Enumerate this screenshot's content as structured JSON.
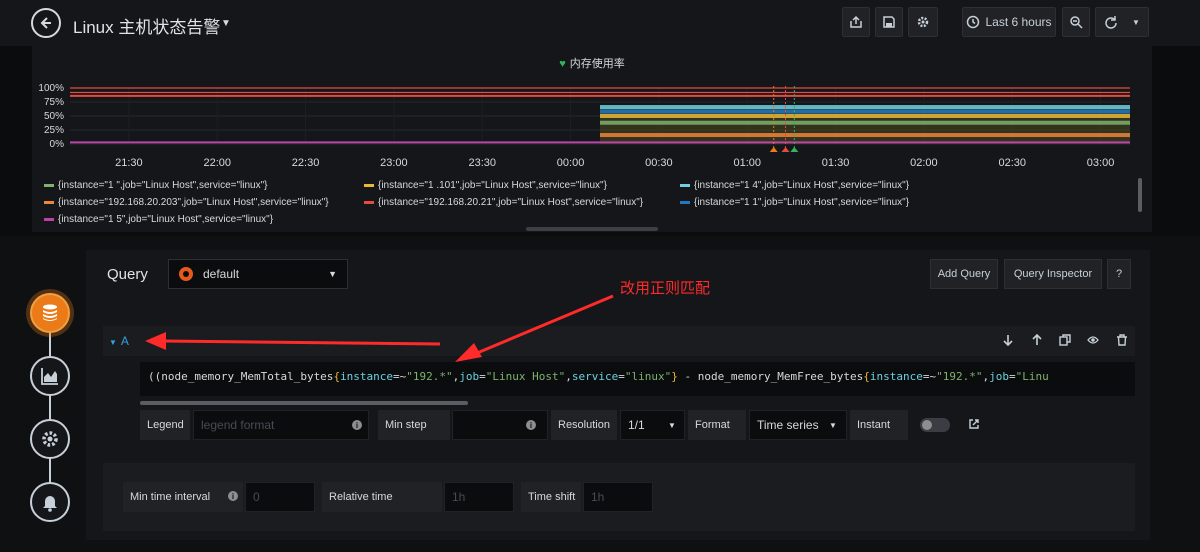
{
  "topbar": {
    "title": "Linux 主机状态告警",
    "time_range": "Last 6 hours"
  },
  "panel": {
    "title": "内存使用率",
    "chart_data": {
      "type": "line",
      "y_ticks": [
        "100%",
        "75%",
        "50%",
        "25%",
        "0%"
      ],
      "x_ticks": [
        "21:30",
        "22:00",
        "22:30",
        "23:00",
        "23:30",
        "00:00",
        "00:30",
        "01:00",
        "01:30",
        "02:00",
        "02:30",
        "03:00"
      ],
      "ylim": [
        0,
        100
      ],
      "series": [
        {
          "color": "#7eb26d",
          "start": "00:10",
          "value": 38
        },
        {
          "color": "#eab839",
          "start": "00:10",
          "value": 50
        },
        {
          "color": "#6ed0e0",
          "start": "00:10",
          "value": 66
        },
        {
          "color": "#ef843c",
          "start": "00:10",
          "value": 16
        },
        {
          "color": "#e24d42",
          "start": "21:10",
          "value": 86
        },
        {
          "color": "#1f78c1",
          "start": "00:10",
          "value": 58
        },
        {
          "color": "#ba43a9",
          "start": "21:10",
          "value": 3
        }
      ],
      "thresholds": [
        {
          "color": "#e24d42",
          "value": 100
        },
        {
          "color": "#e24d42",
          "value": 92
        }
      ],
      "annotations": [
        {
          "color": "#eb7b18",
          "time": "01:09"
        },
        {
          "color": "#e24d42",
          "time": "01:13"
        },
        {
          "color": "#33b35d",
          "time": "01:16"
        }
      ],
      "grid": true
    },
    "legend": [
      {
        "color": "#7eb26d",
        "text": "{instance=\"1          \",job=\"Linux Host\",service=\"linux\"}"
      },
      {
        "color": "#eab839",
        "text": "{instance=\"1         .101\",job=\"Linux Host\",service=\"linux\"}"
      },
      {
        "color": "#6ed0e0",
        "text": "{instance=\"1          4\",job=\"Linux Host\",service=\"linux\"}"
      },
      {
        "color": "#ef843c",
        "text": "{instance=\"192.168.20.203\",job=\"Linux Host\",service=\"linux\"}"
      },
      {
        "color": "#e24d42",
        "text": "{instance=\"192.168.20.21\",job=\"Linux Host\",service=\"linux\"}"
      },
      {
        "color": "#1f78c1",
        "text": "{instance=\"1          1\",job=\"Linux Host\",service=\"linux\"}"
      },
      {
        "color": "#ba43a9",
        "text": "{instance=\"1          5\",job=\"Linux Host\",service=\"linux\"}"
      }
    ]
  },
  "query": {
    "label": "Query",
    "datasource": "default",
    "add_query": "Add Query",
    "query_inspector": "Query Inspector",
    "help": "?",
    "row_letter": "A",
    "annotation": "改用正则匹配",
    "expr_parts": [
      {
        "t": "((node_memory_MemTotal_bytes",
        "c": "#d8d9da"
      },
      {
        "t": "{",
        "c": "#eab839"
      },
      {
        "t": "instance",
        "c": "#6ed0e0"
      },
      {
        "t": "=~",
        "c": "#d8d9da"
      },
      {
        "t": "\"192.*\"",
        "c": "#7eb26d"
      },
      {
        "t": ",",
        "c": "#d8d9da"
      },
      {
        "t": "job",
        "c": "#6ed0e0"
      },
      {
        "t": "=",
        "c": "#d8d9da"
      },
      {
        "t": "\"Linux Host\"",
        "c": "#7eb26d"
      },
      {
        "t": ",",
        "c": "#d8d9da"
      },
      {
        "t": "service",
        "c": "#6ed0e0"
      },
      {
        "t": "=",
        "c": "#d8d9da"
      },
      {
        "t": "\"linux\"",
        "c": "#7eb26d"
      },
      {
        "t": "}",
        "c": "#eab839"
      },
      {
        "t": " - node_memory_MemFree_bytes",
        "c": "#d8d9da"
      },
      {
        "t": "{",
        "c": "#eab839"
      },
      {
        "t": "instance",
        "c": "#6ed0e0"
      },
      {
        "t": "=~",
        "c": "#d8d9da"
      },
      {
        "t": "\"192.*\"",
        "c": "#7eb26d"
      },
      {
        "t": ",",
        "c": "#d8d9da"
      },
      {
        "t": "job",
        "c": "#6ed0e0"
      },
      {
        "t": "=",
        "c": "#d8d9da"
      },
      {
        "t": "\"Linu",
        "c": "#7eb26d"
      }
    ],
    "options": {
      "legend_label": "Legend",
      "legend_placeholder": "legend format",
      "min_step_label": "Min step",
      "resolution_label": "Resolution",
      "resolution_value": "1/1",
      "format_label": "Format",
      "format_value": "Time series",
      "instant_label": "Instant"
    }
  },
  "time_options": {
    "min_interval_label": "Min time interval",
    "min_interval_placeholder": "0",
    "relative_label": "Relative time",
    "relative_placeholder": "1h",
    "shift_label": "Time shift",
    "shift_placeholder": "1h"
  }
}
